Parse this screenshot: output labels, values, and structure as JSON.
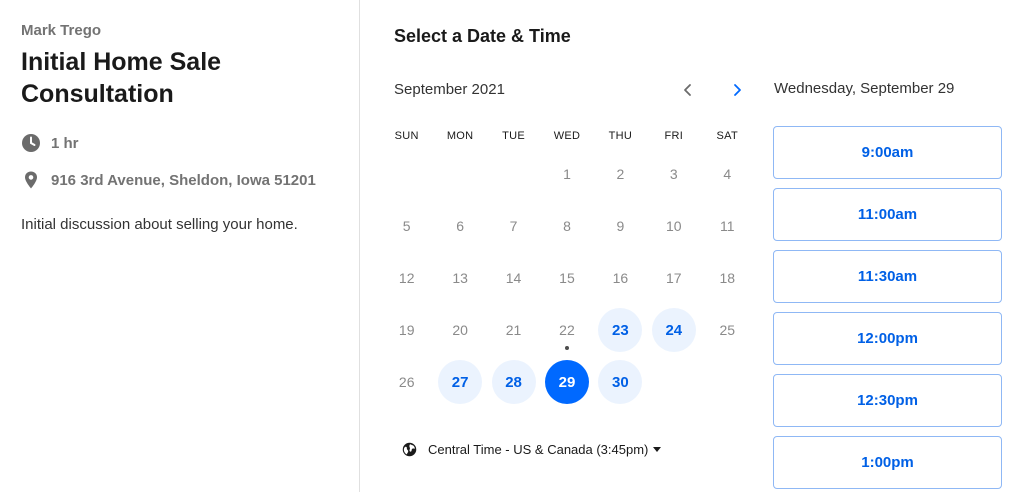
{
  "event": {
    "host_name": "Mark Trego",
    "title": "Initial Home Sale Consultation",
    "duration": "1 hr",
    "location": "916 3rd Avenue, Sheldon, Iowa 51201",
    "description": "Initial discussion about selling your home."
  },
  "calendar": {
    "heading": "Select a Date & Time",
    "month_label": "September 2021",
    "weekdays": [
      "SUN",
      "MON",
      "TUE",
      "WED",
      "THU",
      "FRI",
      "SAT"
    ],
    "leading_blank_days": 3,
    "days": [
      {
        "label": "1",
        "state": "disabled"
      },
      {
        "label": "2",
        "state": "disabled"
      },
      {
        "label": "3",
        "state": "disabled"
      },
      {
        "label": "4",
        "state": "disabled"
      },
      {
        "label": "5",
        "state": "disabled"
      },
      {
        "label": "6",
        "state": "disabled"
      },
      {
        "label": "7",
        "state": "disabled"
      },
      {
        "label": "8",
        "state": "disabled"
      },
      {
        "label": "9",
        "state": "disabled"
      },
      {
        "label": "10",
        "state": "disabled"
      },
      {
        "label": "11",
        "state": "disabled"
      },
      {
        "label": "12",
        "state": "disabled"
      },
      {
        "label": "13",
        "state": "disabled"
      },
      {
        "label": "14",
        "state": "disabled"
      },
      {
        "label": "15",
        "state": "disabled"
      },
      {
        "label": "16",
        "state": "disabled"
      },
      {
        "label": "17",
        "state": "disabled"
      },
      {
        "label": "18",
        "state": "disabled"
      },
      {
        "label": "19",
        "state": "disabled"
      },
      {
        "label": "20",
        "state": "disabled"
      },
      {
        "label": "21",
        "state": "disabled"
      },
      {
        "label": "22",
        "state": "disabled",
        "today": true
      },
      {
        "label": "23",
        "state": "available"
      },
      {
        "label": "24",
        "state": "available"
      },
      {
        "label": "25",
        "state": "disabled"
      },
      {
        "label": "26",
        "state": "disabled"
      },
      {
        "label": "27",
        "state": "available"
      },
      {
        "label": "28",
        "state": "available"
      },
      {
        "label": "29",
        "state": "selected"
      },
      {
        "label": "30",
        "state": "available"
      }
    ],
    "timezone_label": "Central Time - US & Canada (3:45pm)"
  },
  "times": {
    "selected_date_label": "Wednesday, September 29",
    "slots": [
      "9:00am",
      "11:00am",
      "11:30am",
      "12:00pm",
      "12:30pm",
      "1:00pm"
    ]
  },
  "icons": {
    "duration": "clock-icon",
    "location": "map-pin-icon",
    "timezone": "globe-icon",
    "prev": "chevron-left-icon",
    "next": "chevron-right-icon"
  },
  "colors": {
    "accent": "#0069ff",
    "available_bg": "#ebf3fe",
    "slot_border": "#8fb8f5"
  }
}
